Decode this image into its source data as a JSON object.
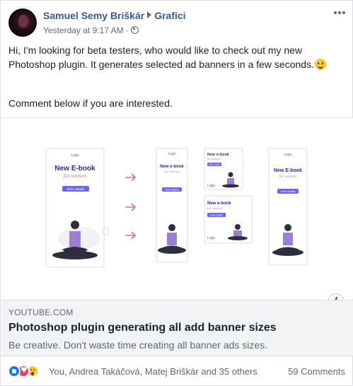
{
  "post": {
    "author": "Samuel Semy Briškár",
    "group": "Grafici",
    "timestamp": "Yesterday at 9:17 AM",
    "privacy_icon": "globe-icon",
    "message_line1": "Hi, I'm looking for beta testers, who would like to check out my new",
    "message_line2": "Photoshop plugin. It generates selected ad banners in a few seconds.",
    "message_emoji": "smile-emoji",
    "message_line3": "Comment below if you are interested."
  },
  "link_preview": {
    "domain": "YOUTUBE.COM",
    "title": "Photoshop plugin generating all add banner sizes",
    "description": "Be creative. Don't waste time creating all banner ads sizes.",
    "banners": {
      "logo": "Logo",
      "title_large": "New E-book",
      "title_small": "New e-book",
      "subtitle": "for women",
      "button": "More details"
    }
  },
  "footer": {
    "reactions": [
      "like",
      "love",
      "wow"
    ],
    "reaction_names": "You, Andrea Takáčová, Matej Briškár and 35 others",
    "comments_count": "59 Comments"
  },
  "colors": {
    "link_blue": "#385898",
    "banner_title": "#2b2b8f",
    "banner_accent": "#e26a8a",
    "banner_button": "#6c63ff"
  }
}
